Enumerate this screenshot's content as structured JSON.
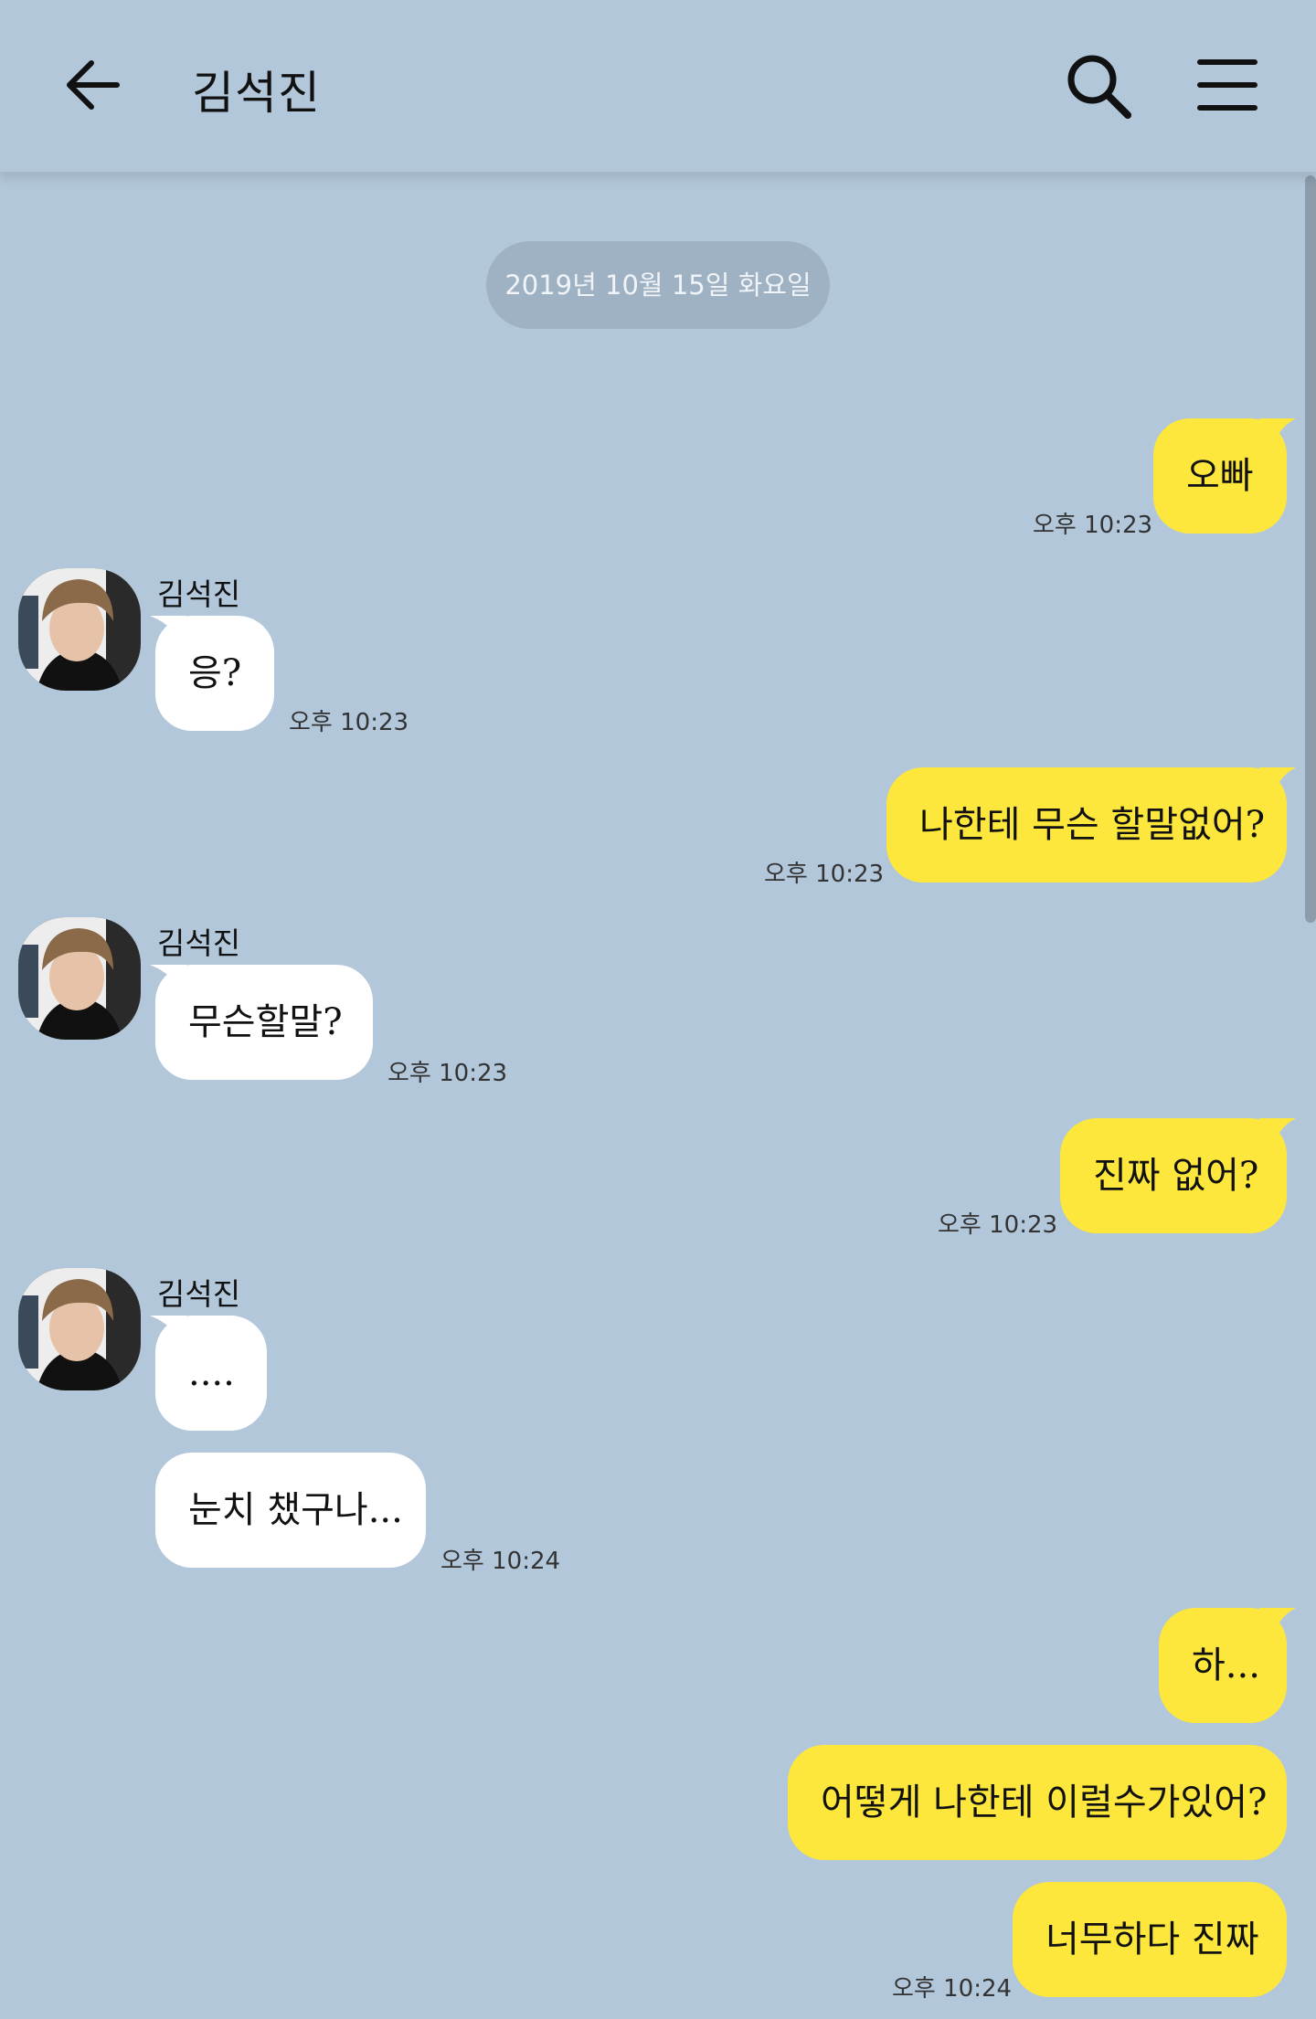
{
  "header": {
    "title": "김석진",
    "back_icon": "arrow-left-icon",
    "search_icon": "search-icon",
    "menu_icon": "hamburger-menu-icon"
  },
  "date_divider": "2019년 10월 15일 화요일",
  "colors": {
    "background": "#b2c7da",
    "my_bubble": "#fde73d",
    "their_bubble": "#ffffff"
  },
  "messages": [
    {
      "sender": "me",
      "text": "오빠",
      "time": "오후 10:23"
    },
    {
      "sender": "김석진",
      "text": "응?",
      "time": "오후 10:23"
    },
    {
      "sender": "me",
      "text": "나한테 무슨 할말없어?",
      "time": "오후 10:23"
    },
    {
      "sender": "김석진",
      "text": "무슨할말?",
      "time": "오후 10:23"
    },
    {
      "sender": "me",
      "text": "진짜 없어?",
      "time": "오후 10:23"
    },
    {
      "sender": "김석진",
      "text": "....",
      "time": ""
    },
    {
      "sender": "김석진",
      "text": "눈치 챘구나...",
      "time": "오후 10:24"
    },
    {
      "sender": "me",
      "text": "하...",
      "time": ""
    },
    {
      "sender": "me",
      "text": "어떻게 나한테 이럴수가있어?",
      "time": ""
    },
    {
      "sender": "me",
      "text": "너무하다 진짜",
      "time": "오후 10:24"
    }
  ]
}
